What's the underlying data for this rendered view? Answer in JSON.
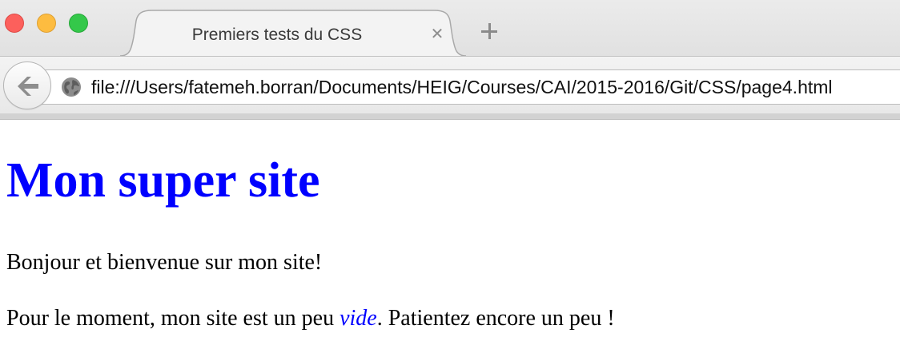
{
  "window": {
    "traffic_lights": {
      "close_color": "#fc605c",
      "minimize_color": "#fdbc40",
      "maximize_color": "#34c84a"
    }
  },
  "tabs": [
    {
      "title": "Premiers tests du CSS",
      "close_icon": "close-icon",
      "active": true
    }
  ],
  "new_tab_icon": "plus-icon",
  "nav": {
    "back_icon": "back-arrow-icon",
    "site_icon": "globe-icon",
    "url": "file:///Users/fatemeh.borran/Documents/HEIG/Courses/CAI/2015-2016/Git/CSS/page4.html"
  },
  "page": {
    "heading": "Mon super site",
    "heading_color": "#0000ff",
    "paragraph1": "Bonjour et bienvenue sur mon site!",
    "paragraph2": {
      "before": "Pour le moment, mon site est un peu ",
      "emphasis": "vide",
      "after": ". Patientez encore un peu !"
    },
    "emphasis_color": "#0000ff"
  }
}
